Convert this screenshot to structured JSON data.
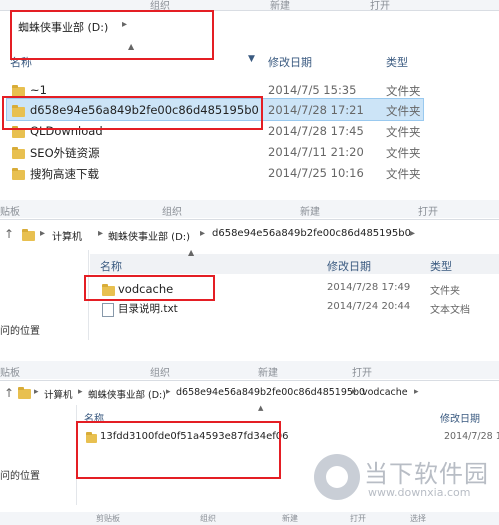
{
  "panel1": {
    "ribbon": [
      "组织",
      "新建",
      "打开"
    ],
    "address": [
      "蜘蛛侠事业部 (D:)",
      "▸"
    ],
    "headers": {
      "name": "名称",
      "date": "修改日期",
      "type": "类型"
    },
    "rows": [
      {
        "name": "~1",
        "date": "2014/7/5 15:35",
        "type": "文件夹"
      },
      {
        "name": "d658e94e56a849b2fe00c86d485195b0",
        "date": "2014/7/28 17:21",
        "type": "文件夹"
      },
      {
        "name": "QLDownload",
        "date": "2014/7/28 17:45",
        "type": "文件夹"
      },
      {
        "name": "SEO外链资源",
        "date": "2014/7/11 21:20",
        "type": "文件夹"
      },
      {
        "name": "搜狗高速下载",
        "date": "2014/7/25 10:16",
        "type": "文件夹"
      }
    ]
  },
  "panel2": {
    "ribbon": [
      "贴板",
      "组织",
      "新建",
      "打开"
    ],
    "address": [
      "计算机",
      "蜘蛛侠事业部 (D:)",
      "d658e94e56a849b2fe00c86d485195b0"
    ],
    "headers": {
      "name": "名称",
      "date": "修改日期",
      "type": "类型"
    },
    "side_label": "问的位置",
    "rows": [
      {
        "name": "vodcache",
        "date": "2014/7/28 17:49",
        "type": "文件夹"
      },
      {
        "name": "目录说明.txt",
        "date": "2014/7/24 20:44",
        "type": "文本文档"
      }
    ]
  },
  "panel3": {
    "ribbon": [
      "贴板",
      "组织",
      "新建",
      "打开"
    ],
    "address": [
      "计算机",
      "蜘蛛侠事业部 (D:)",
      "d658e94e56a849b2fe00c86d485195b0",
      "vodcache"
    ],
    "headers": {
      "name": "名称",
      "date": "修改日期"
    },
    "side_label": "问的位置",
    "rows": [
      {
        "name": "13fdd3100fde0f51a4593e87fd34ef06",
        "date": "2014/7/28 1"
      }
    ],
    "bottom_ribbon": [
      "剪贴板",
      "组织",
      "新建",
      "打开",
      "选择"
    ]
  },
  "watermark": {
    "title": "当下软件园",
    "url": "www.downxia.com"
  },
  "colors": {
    "accent": "#e41e24",
    "selection": "#cce4f7",
    "folder": "#e8c050"
  }
}
